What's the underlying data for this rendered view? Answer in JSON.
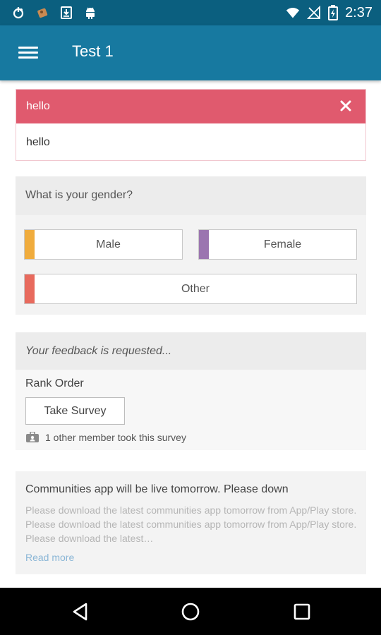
{
  "status_bar": {
    "time": "2:37",
    "icons": [
      "notification-icon",
      "app-icon",
      "download-icon",
      "android-icon",
      "wifi-icon",
      "no-signal-icon",
      "battery-icon"
    ]
  },
  "app_bar": {
    "title": "Test 1",
    "menu_icon": "hamburger-icon",
    "color": "#1779a0"
  },
  "alert": {
    "title": "hello",
    "body": "hello",
    "color": "#e05a6e"
  },
  "poll": {
    "question": "What is your gender?",
    "options": [
      {
        "label": "Male",
        "color": "#f0ac3d"
      },
      {
        "label": "Female",
        "color": "#9b75b0"
      },
      {
        "label": "Other",
        "color": "#e86a5d"
      }
    ]
  },
  "survey": {
    "prompt": "Your feedback is requested...",
    "type": "Rank Order",
    "button_label": "Take Survey",
    "meta": "1 other member took this survey"
  },
  "announcement": {
    "title": "Communities app will be live tomorrow. Please down",
    "body": "Please download the latest communities app tomorrow from App/Play store. Please download the latest communities app tomorrow from App/Play store. Please download the latest…",
    "read_more": "Read more"
  }
}
